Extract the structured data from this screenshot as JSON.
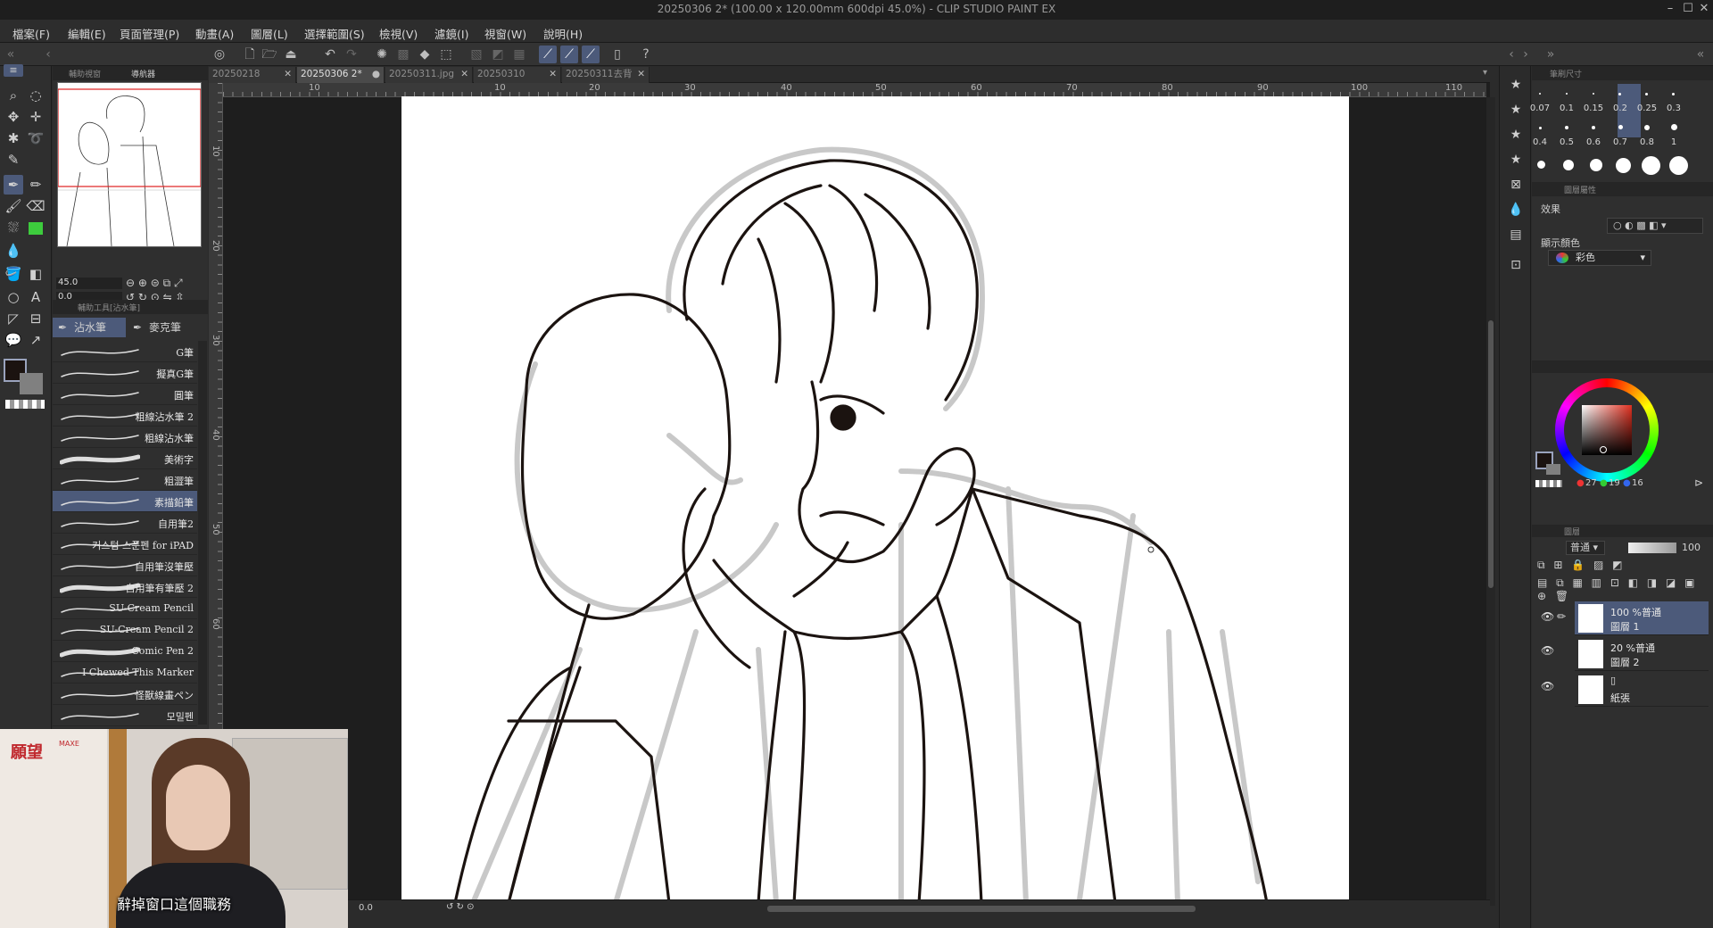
{
  "window": {
    "title": "20250306 2* (100.00 x 120.00mm 600dpi 45.0%) - CLIP STUDIO PAINT EX"
  },
  "menu": [
    "檔案(F)",
    "編輯(E)",
    "頁面管理(P)",
    "動畫(A)",
    "圖層(L)",
    "選擇範圍(S)",
    "檢視(V)",
    "濾鏡(I)",
    "視窗(W)",
    "說明(H)"
  ],
  "document_tabs": [
    {
      "label": "20250218",
      "active": false
    },
    {
      "label": "20250306 2*",
      "active": true
    },
    {
      "label": "20250311.jpg",
      "active": false
    },
    {
      "label": "20250310",
      "active": false
    },
    {
      "label": "20250311去背",
      "active": false
    }
  ],
  "navigator": {
    "tab_label_1": "輔助視窗",
    "tab_label_2": "導航器",
    "zoom_value": "45.0",
    "rotate_value": "0.0"
  },
  "sub_tool": {
    "panel_label": "輔助工具[沾水筆]",
    "tabs": [
      "沾水筆",
      "麥克筆"
    ],
    "brushes": [
      "G筆",
      "擬真G筆",
      "圓筆",
      "粗線沾水筆 2",
      "粗線沾水筆",
      "美術字",
      "粗澀筆",
      "素描鉛筆",
      "自用筆2",
      "커스텀 스푼펜 for iPAD",
      "自用筆沒筆壓",
      "自用筆有筆壓 2",
      "SU-Cream Pencil",
      "SU-Cream Pencil 2",
      "Comic Pen 2",
      "I Chewed This Marker",
      "怪獸線畫ペン",
      "모밀펜"
    ],
    "selected_brush": "素描鉛筆"
  },
  "ruler": {
    "h_labels": [
      "10",
      "0",
      "10",
      "20",
      "30",
      "40",
      "50",
      "60",
      "70",
      "80",
      "90",
      "100",
      "110"
    ],
    "v_labels": [
      "10",
      "20",
      "30",
      "40",
      "50",
      "60"
    ]
  },
  "status": {
    "zoom": "0.0"
  },
  "brush_size": {
    "panel_label": "筆刷尺寸",
    "row1": [
      "0.07",
      "0.1",
      "0.15",
      "0.2",
      "0.25",
      "0.3"
    ],
    "row2": [
      "0.4",
      "0.5",
      "0.6",
      "0.7",
      "0.8",
      "1"
    ],
    "selected": "0.7"
  },
  "layer_property": {
    "panel_label": "圖層屬性",
    "effect_label": "效果",
    "display_color_label": "顯示顏色",
    "display_color_value": "彩色"
  },
  "color": {
    "r": "27",
    "g": "19",
    "b": "16",
    "main_color": "#1b1310",
    "sub_color": "#808080"
  },
  "layers": {
    "panel_label": "圖層",
    "blend_mode": "普通",
    "opacity": "100",
    "items": [
      {
        "line1": "100 %普通",
        "line2": "圖層 1",
        "selected": true
      },
      {
        "line1": "20 %普通",
        "line2": "圖層 2",
        "selected": false
      },
      {
        "line1": "",
        "line2": "紙張",
        "selected": false
      }
    ]
  },
  "video": {
    "caption": "辭掉窗口這個職務",
    "logo_text": "願望",
    "logo_sub": "MAXE"
  }
}
